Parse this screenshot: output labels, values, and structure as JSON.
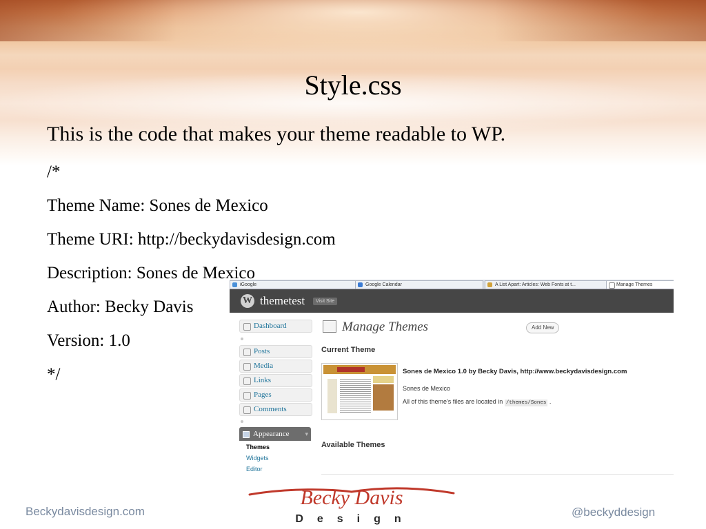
{
  "slide": {
    "title": "Style.css",
    "lines": [
      "This is the code that makes your theme readable to WP.",
      "/*",
      "Theme Name: Sones de Mexico",
      "Theme URI: http://beckydavisdesign.com",
      "Description: Sones de Mexico",
      "Author: Becky Davis",
      "Version: 1.0",
      "*/"
    ]
  },
  "screenshot": {
    "browser_tabs": [
      "iGoogle",
      "Google Calendar",
      "A List Apart: Articles: Web Fonts at t...",
      "Manage Themes"
    ],
    "site_name": "themetest",
    "visit_site": "Visit Site",
    "menu": {
      "dashboard": "Dashboard",
      "posts": "Posts",
      "media": "Media",
      "links": "Links",
      "pages": "Pages",
      "comments": "Comments",
      "appearance": "Appearance",
      "sub": [
        "Themes",
        "Widgets",
        "Editor"
      ]
    },
    "page_title": "Manage Themes",
    "add_new": "Add New",
    "current_theme_heading": "Current Theme",
    "theme_title": "Sones de Mexico 1.0 by Becky Davis, http://www.beckydavisdesign.com",
    "theme_description": "Sones de Mexico",
    "theme_files_text": "All of this theme's files are located in",
    "theme_files_path": "/themes/Sones",
    "theme_files_end": ".",
    "available_themes_heading": "Available Themes"
  },
  "footer": {
    "left": "Beckydavisdesign.com",
    "right": "@beckyddesign",
    "logo_text_top": "Becky Davis",
    "logo_text_bottom": "Design"
  },
  "colors": {
    "wp_header": "#464646",
    "link_blue": "#21759b",
    "footer_text": "#7a8aa0",
    "logo_red": "#c0392b"
  }
}
